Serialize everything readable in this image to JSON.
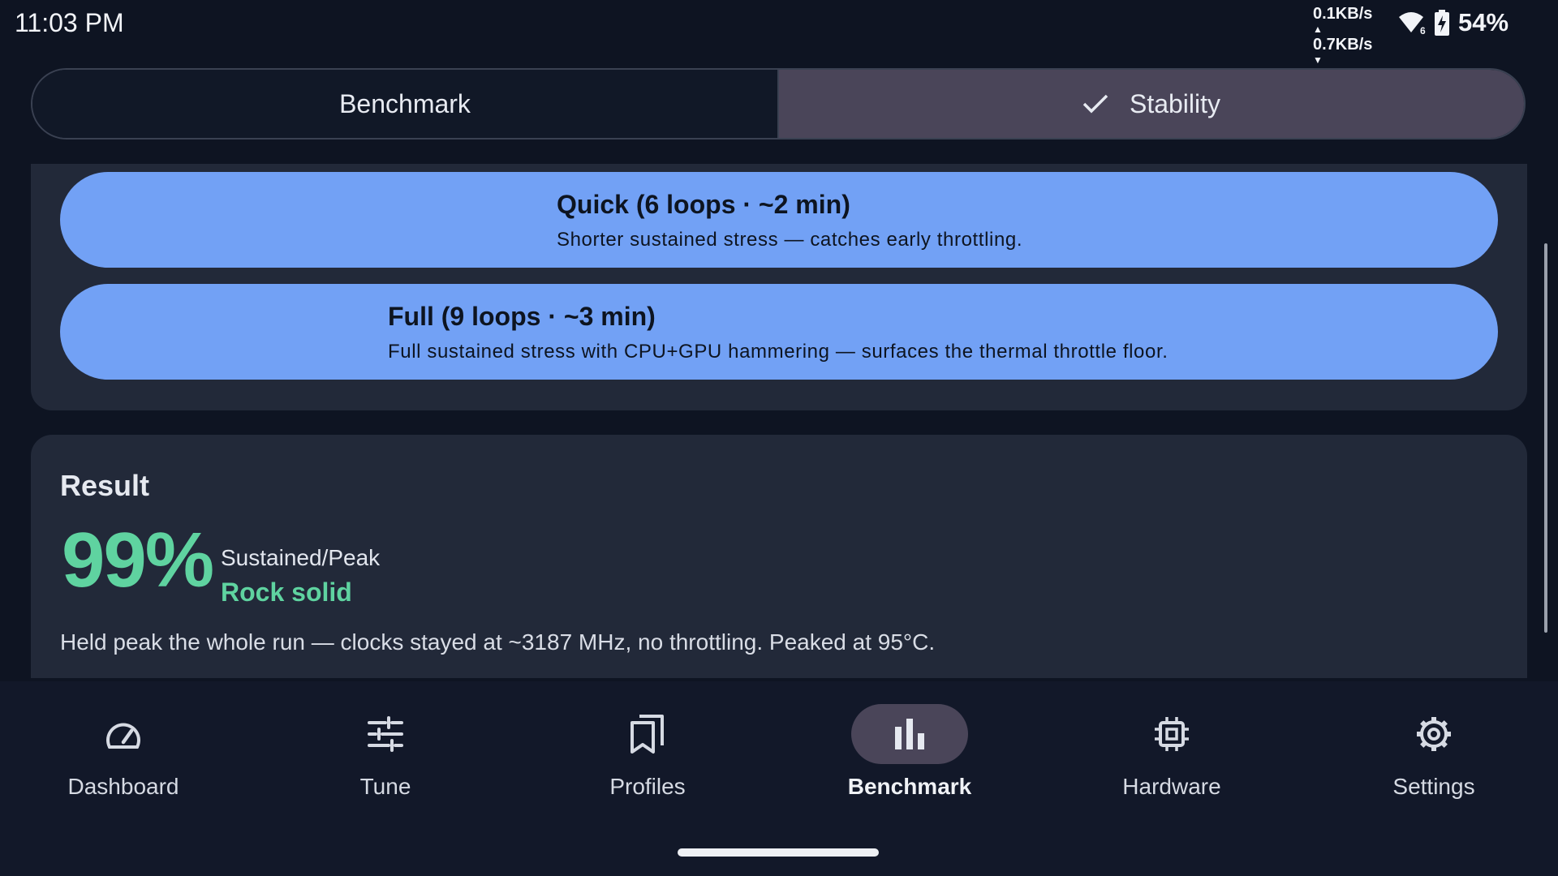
{
  "status_bar": {
    "time": "11:03 PM",
    "upload_speed": "0.1KB/s",
    "download_speed": "0.7KB/s",
    "network_badge": "6",
    "battery": "54%"
  },
  "tabs": [
    {
      "label": "Benchmark",
      "selected": false
    },
    {
      "label": "Stability",
      "selected": true
    }
  ],
  "options": {
    "quick": {
      "title": "Quick  (6 loops · ~2 min)",
      "description": "Shorter sustained stress — catches early throttling."
    },
    "full": {
      "title": "Full  (9 loops · ~3 min)",
      "description": "Full sustained stress with CPU+GPU hammering — surfaces the thermal throttle floor."
    }
  },
  "result": {
    "heading": "Result",
    "value": "99%",
    "label": "Sustained/Peak",
    "verdict": "Rock solid",
    "description": "Held peak the whole run — clocks stayed at ~3187 MHz, no throttling. Peaked at 95°C."
  },
  "nav": [
    {
      "label": "Dashboard",
      "icon": "gauge-icon"
    },
    {
      "label": "Tune",
      "icon": "sliders-icon"
    },
    {
      "label": "Profiles",
      "icon": "bookmarks-icon"
    },
    {
      "label": "Benchmark",
      "icon": "bar-chart-icon",
      "active": true
    },
    {
      "label": "Hardware",
      "icon": "chip-icon"
    },
    {
      "label": "Settings",
      "icon": "gear-icon"
    }
  ],
  "colors": {
    "background": "#0e1422",
    "card": "#222939",
    "option_button": "#72a1f5",
    "selected_tab": "#4a4559",
    "accent_green": "#5fd3a0"
  }
}
